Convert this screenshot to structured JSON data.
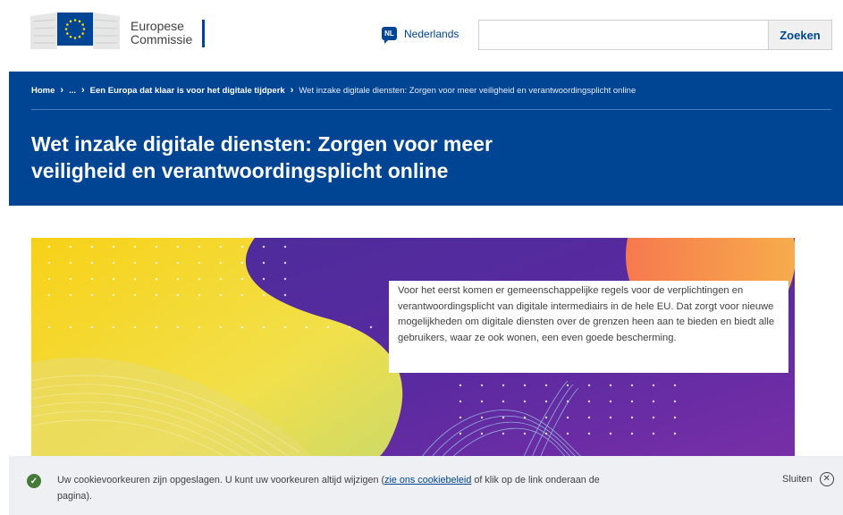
{
  "header": {
    "logo_line1": "Europese",
    "logo_line2": "Commissie",
    "language_code": "NL",
    "language_label": "Nederlands",
    "search_placeholder": "",
    "search_button": "Zoeken"
  },
  "breadcrumb": {
    "items": [
      "Home",
      "...",
      "Een Europa dat klaar is voor het digitale tijdperk"
    ],
    "current": "Wet inzake digitale diensten: Zorgen voor meer veiligheid en verantwoordingsplicht online"
  },
  "page_title": "Wet inzake digitale diensten: Zorgen voor meer veiligheid en verantwoordingsplicht online",
  "hero": {
    "text": "Voor het eerst komen er gemeenschappelijke regels voor de verplichtingen en verantwoordingsplicht van digitale intermediairs in de hele EU. Dat zorgt voor nieuwe mogelijkheden om digitale diensten over de grenzen heen aan te bieden en biedt alle gebruikers, waar ze ook wonen, een even goede bescherming."
  },
  "cookie": {
    "text_before": "Uw cookievoorkeuren zijn opgeslagen. U kunt uw voorkeuren altijd wijzigen (",
    "link": "zie ons cookiebeleid",
    "text_after": " of klik op de link onderaan de pagina).",
    "close_label": "Sluiten"
  },
  "colors": {
    "brand_blue": "#004494",
    "hero_purple": "#5a2aa0",
    "hero_yellow": "#f7d117",
    "success_green": "#467a39"
  },
  "icons": {
    "eu_flag": "eu-flag-icon",
    "language": "speech-bubble-icon",
    "success": "check-circle-icon",
    "close": "close-circle-icon"
  }
}
